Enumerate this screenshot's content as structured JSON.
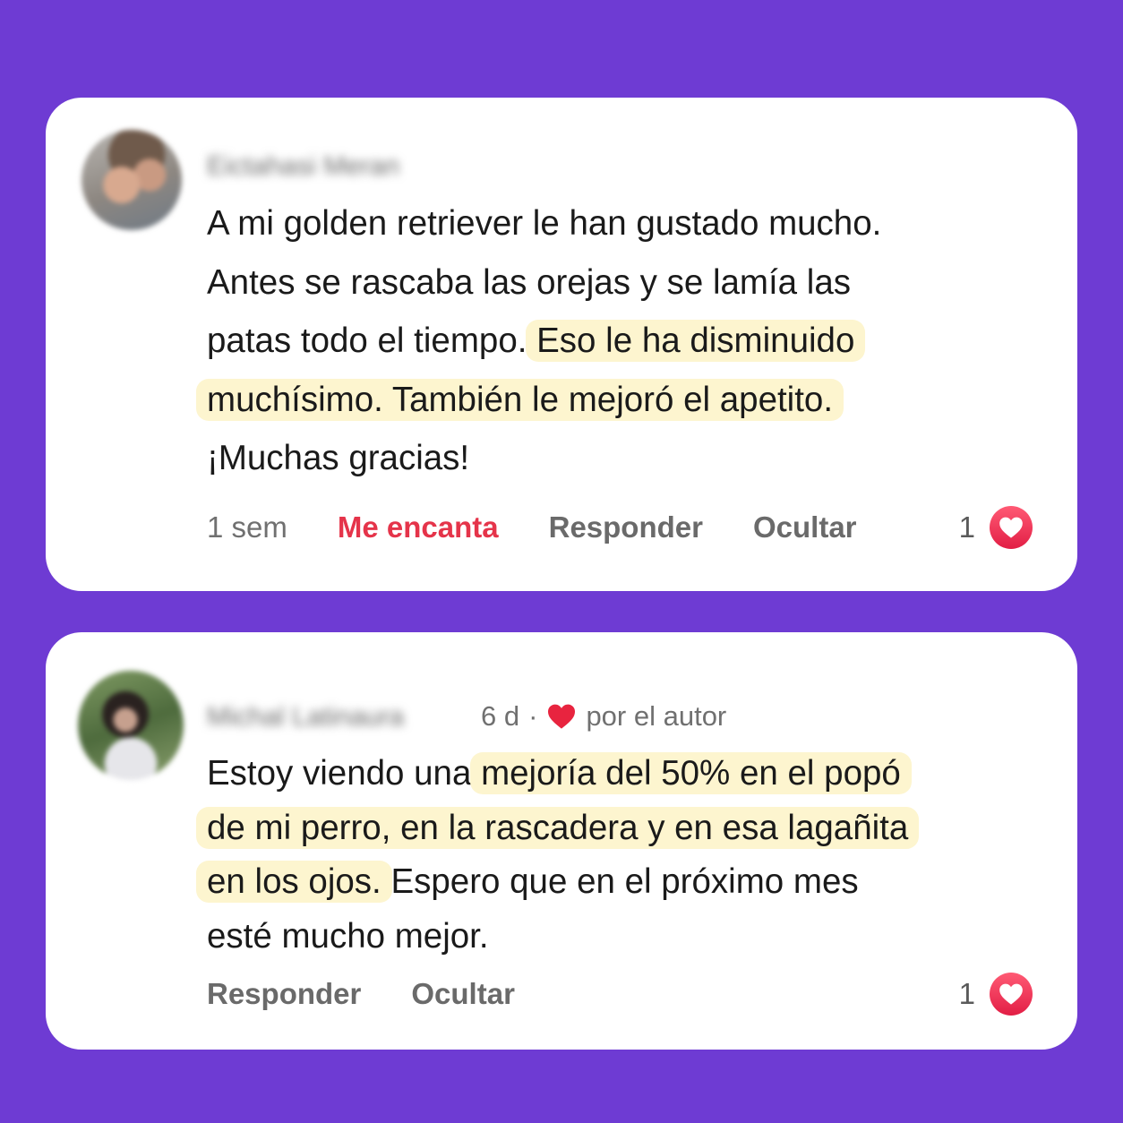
{
  "colors": {
    "background": "#6e3bd3",
    "card": "#ffffff",
    "highlight": "#fdf5cf",
    "love": "#e5344a"
  },
  "comments": [
    {
      "author": "Eictahasi Meran",
      "lines": [
        [
          {
            "text": "A mi golden  retriever le han gustado mucho.",
            "hl": false
          }
        ],
        [
          {
            "text": "Antes se rascaba las orejas y se lamía las",
            "hl": false
          }
        ],
        [
          {
            "text": "patas todo el tiempo. ",
            "hl": false
          },
          {
            "text": "Eso le ha disminuido",
            "hl": true
          }
        ],
        [
          {
            "text": "muchísimo. También le mejoró el apetito.",
            "hl": true
          }
        ],
        [
          {
            "text": "¡Muchas gracias!",
            "hl": false
          }
        ]
      ],
      "actions": {
        "time": "1 sem",
        "love": "Me encanta",
        "reply": "Responder",
        "hide": "Ocultar"
      },
      "reaction_count": "1",
      "reaction_icon": "heart-icon"
    },
    {
      "author": "Michal Latinaura",
      "meta": {
        "time": "6 d",
        "separator": "·",
        "loved_by": "por el autor"
      },
      "lines": [
        [
          {
            "text": "Estoy viendo una ",
            "hl": false
          },
          {
            "text": "mejoría del 50% en el popó",
            "hl": true
          }
        ],
        [
          {
            "text": "de mi perro, en la rascadera y en esa lagañita",
            "hl": true
          }
        ],
        [
          {
            "text": "en los ojos.",
            "hl": true
          },
          {
            "text": " Espero que en el próximo mes",
            "hl": false
          }
        ],
        [
          {
            "text": "esté mucho mejor.",
            "hl": false
          }
        ]
      ],
      "actions": {
        "reply": "Responder",
        "hide": "Ocultar"
      },
      "reaction_count": "1",
      "reaction_icon": "heart-icon"
    }
  ]
}
